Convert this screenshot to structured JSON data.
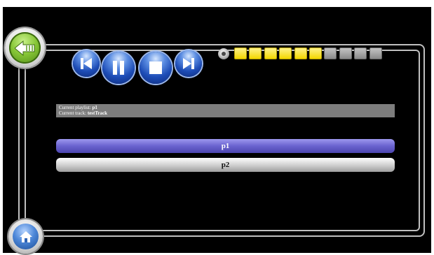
{
  "player": {
    "current_playlist_label": "Current playlist:",
    "current_playlist_value": "p1",
    "current_track_label": "Current track:",
    "current_track_value": "testTrack"
  },
  "volume": {
    "level": 6,
    "max": 10,
    "on_color": "#f2d600",
    "off_color": "#a0a0a0"
  },
  "playlists": [
    {
      "label": "p1",
      "selected": true
    },
    {
      "label": "p2",
      "selected": false
    }
  ],
  "icons": {
    "back": "back-arrow-icon",
    "home": "home-icon",
    "previous": "skip-previous-icon",
    "pause": "pause-icon",
    "stop": "stop-icon",
    "next": "skip-next-icon",
    "volume": "speaker-icon"
  },
  "colors": {
    "background": "#000000",
    "selected_row": "#6a63cf",
    "info_bar": "#7d7d7d"
  }
}
